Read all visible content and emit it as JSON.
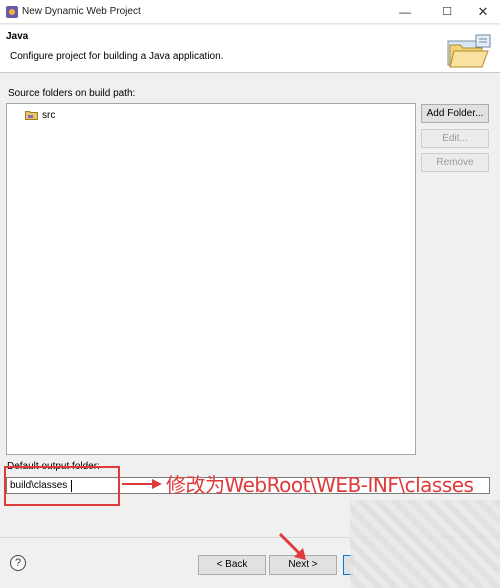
{
  "window": {
    "title": "New Dynamic Web Project",
    "controls": {
      "minimize": "—",
      "maximize": "☐",
      "close": "✕"
    }
  },
  "header": {
    "title": "Java",
    "description": "Configure project for building a Java application."
  },
  "source_folders": {
    "label": "Source folders on build path:",
    "items": [
      {
        "label": "src",
        "icon": "source-folder-icon"
      }
    ]
  },
  "buttons": {
    "add_folder": "Add Folder...",
    "edit": "Edit...",
    "remove": "Remove"
  },
  "output": {
    "label": "Default output folder:",
    "value": "build\\classes"
  },
  "annotation": {
    "text": "修改为WebRoot\\WEB-INF\\classes",
    "color": "#e03a3a"
  },
  "footer": {
    "help": "?",
    "back": "< Back",
    "next": "Next >"
  }
}
